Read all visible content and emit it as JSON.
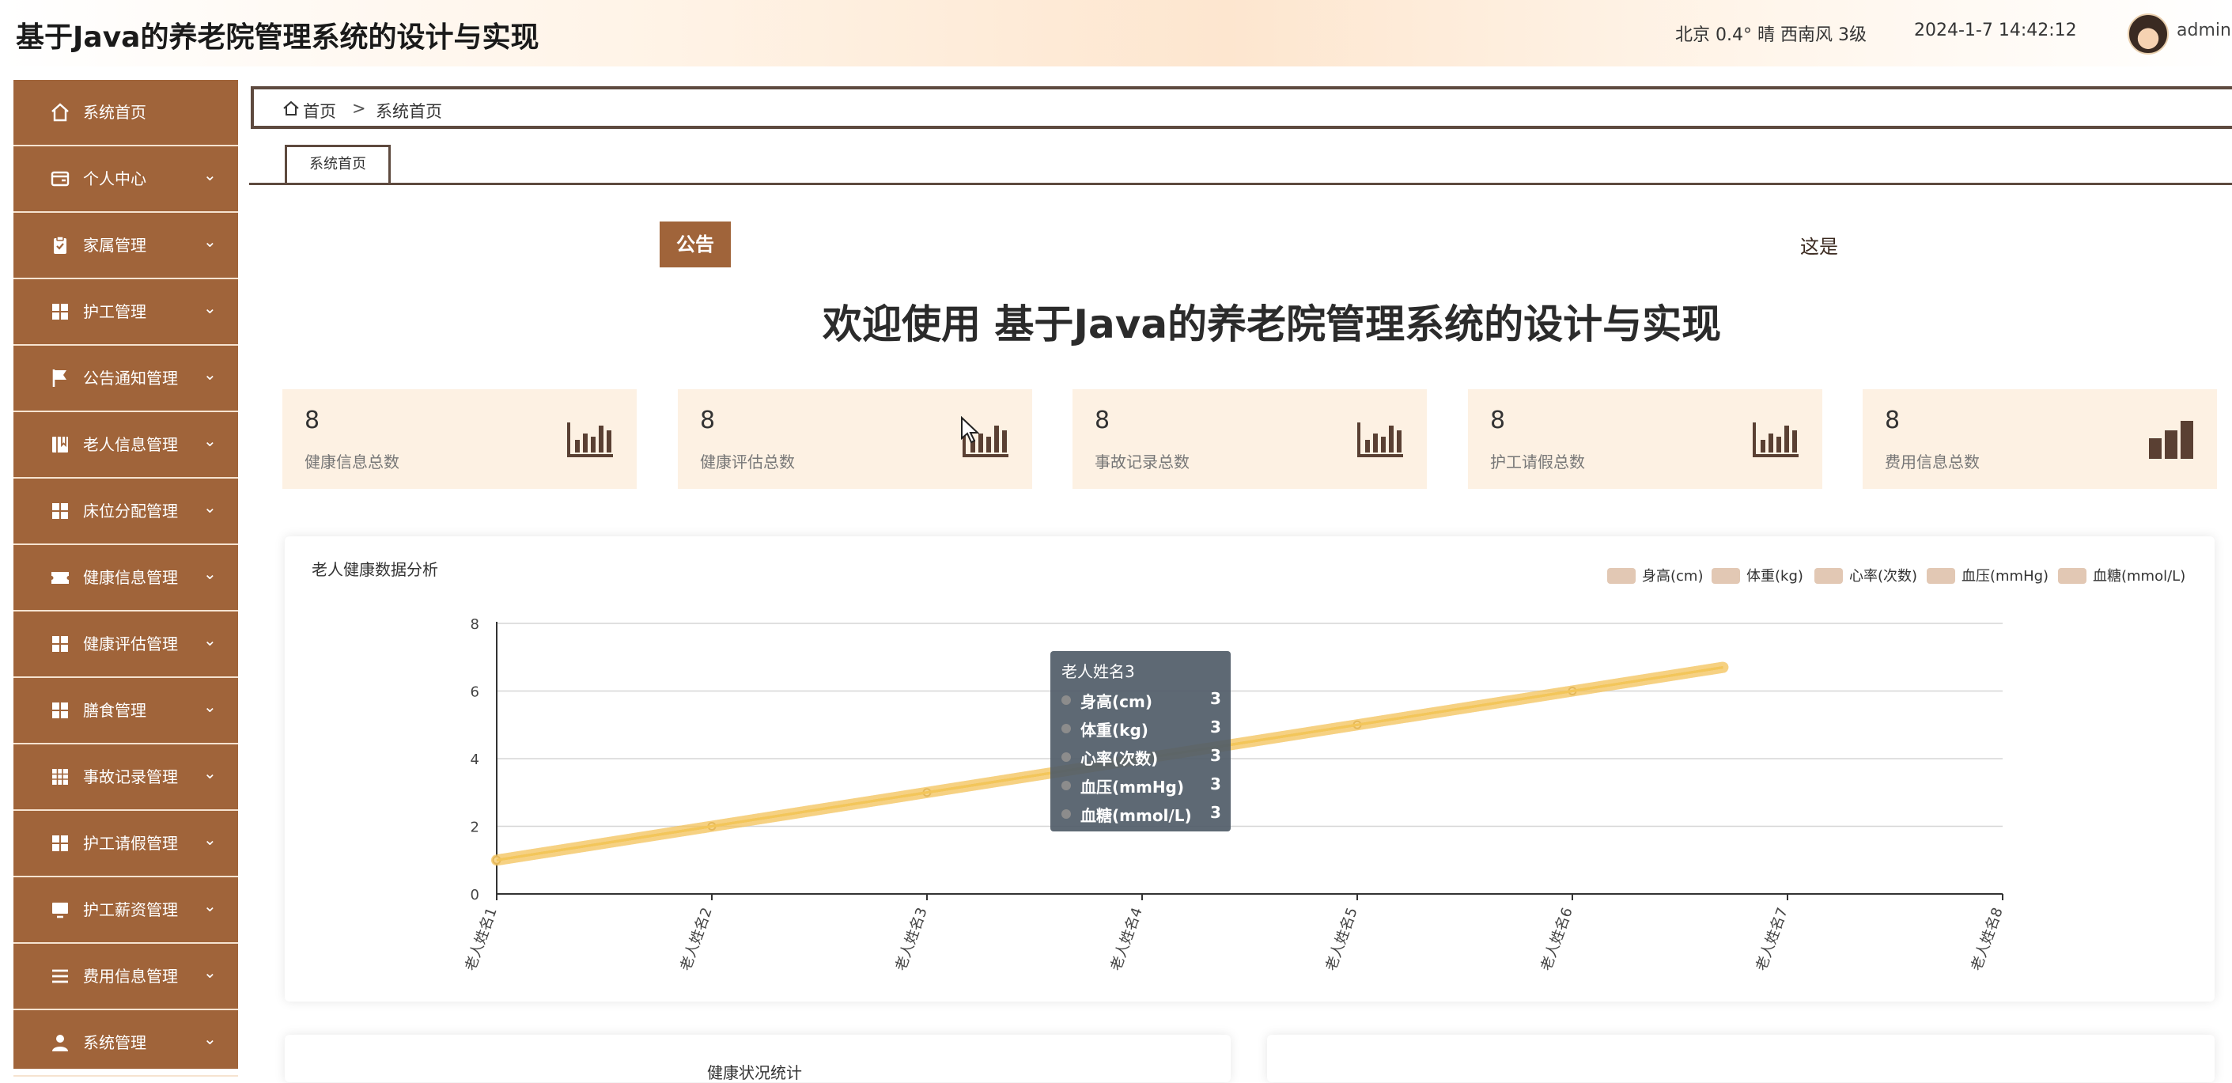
{
  "header": {
    "app_title": "基于Java的养老院管理系统的设计与实现",
    "weather": "北京  0.4°  晴  西南风  3级",
    "datetime": "2024-1-7 14:42:12",
    "username": "admin"
  },
  "sidebar": {
    "items": [
      {
        "label": "系统首页",
        "icon": "home-icon",
        "has_caret": false
      },
      {
        "label": "个人中心",
        "icon": "wallet-icon",
        "has_caret": true
      },
      {
        "label": "家属管理",
        "icon": "clipboard-icon",
        "has_caret": true
      },
      {
        "label": "护工管理",
        "icon": "grid-icon",
        "has_caret": true
      },
      {
        "label": "公告通知管理",
        "icon": "flag-icon",
        "has_caret": true
      },
      {
        "label": "老人信息管理",
        "icon": "book-icon",
        "has_caret": true
      },
      {
        "label": "床位分配管理",
        "icon": "grid-icon",
        "has_caret": true
      },
      {
        "label": "健康信息管理",
        "icon": "ticket-icon",
        "has_caret": true
      },
      {
        "label": "健康评估管理",
        "icon": "grid-icon",
        "has_caret": true
      },
      {
        "label": "膳食管理",
        "icon": "grid-icon",
        "has_caret": true
      },
      {
        "label": "事故记录管理",
        "icon": "table-icon",
        "has_caret": true
      },
      {
        "label": "护工请假管理",
        "icon": "grid-icon",
        "has_caret": true
      },
      {
        "label": "护工薪资管理",
        "icon": "monitor-icon",
        "has_caret": true
      },
      {
        "label": "费用信息管理",
        "icon": "list-icon",
        "has_caret": true
      },
      {
        "label": "系统管理",
        "icon": "user-icon",
        "has_caret": true
      }
    ],
    "caret": "⌄"
  },
  "breadcrumb": {
    "home": "首页",
    "separator": ">",
    "current": "系统首页"
  },
  "tabs": [
    {
      "label": "系统首页",
      "active": true
    }
  ],
  "notice": {
    "badge": "公告",
    "marquee_text": "这是"
  },
  "welcome": "欢迎使用 基于Java的养老院管理系统的设计与实现",
  "stats": [
    {
      "value": "8",
      "label": "健康信息总数"
    },
    {
      "value": "8",
      "label": "健康评估总数"
    },
    {
      "value": "8",
      "label": "事故记录总数"
    },
    {
      "value": "8",
      "label": "护工请假总数"
    },
    {
      "value": "8",
      "label": "费用信息总数"
    }
  ],
  "chart_panel": {
    "title": "老人健康数据分析"
  },
  "chart_data": {
    "type": "line",
    "title": "老人健康数据分析",
    "categories": [
      "老人姓名1",
      "老人姓名2",
      "老人姓名3",
      "老人姓名4",
      "老人姓名5",
      "老人姓名6",
      "老人姓名7",
      "老人姓名8"
    ],
    "series": [
      {
        "name": "身高(cm)",
        "values": [
          1,
          2,
          3,
          4,
          5,
          6,
          null,
          null
        ]
      },
      {
        "name": "体重(kg)",
        "values": [
          1,
          2,
          3,
          4,
          5,
          6,
          null,
          null
        ]
      },
      {
        "name": "心率(次数)",
        "values": [
          1,
          2,
          3,
          4,
          5,
          6,
          null,
          null
        ]
      },
      {
        "name": "血压(mmHg)",
        "values": [
          1,
          2,
          3,
          4,
          5,
          6,
          null,
          null
        ]
      },
      {
        "name": "血糖(mmol/L)",
        "values": [
          1,
          2,
          3,
          4,
          5,
          6,
          null,
          null
        ]
      }
    ],
    "yticks": [
      "0",
      "2",
      "4",
      "6",
      "8"
    ],
    "ylim": [
      0,
      8
    ],
    "grid": true,
    "legend_position": "top-right",
    "line_color": "#f3c55a",
    "legend_color": "#e2c8b4"
  },
  "tooltip": {
    "title": "老人姓名3",
    "rows": [
      {
        "name": "身高(cm)",
        "value": "3"
      },
      {
        "name": "体重(kg)",
        "value": "3"
      },
      {
        "name": "心率(次数)",
        "value": "3"
      },
      {
        "name": "血压(mmHg)",
        "value": "3"
      },
      {
        "name": "血糖(mmol/L)",
        "value": "3"
      }
    ]
  },
  "bottom_panels": {
    "left_title": "健康状况统计"
  },
  "colors": {
    "sidebar": "#a0643a",
    "accent_dark": "#5e4a3f",
    "card_bg": "#fdf1e3",
    "icon_brown": "#5a4033"
  }
}
